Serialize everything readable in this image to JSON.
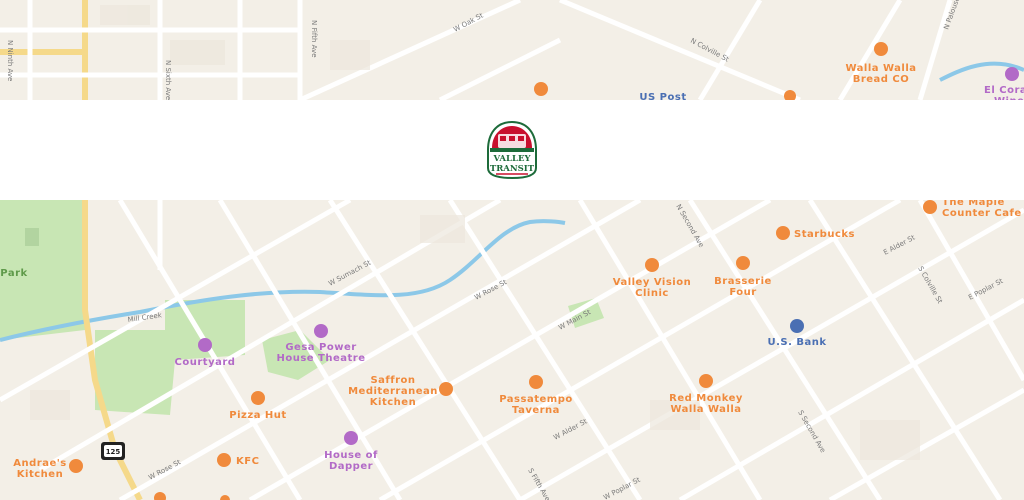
{
  "colors": {
    "background": "#f3efe7",
    "road": "#ffffff",
    "park": "#c8e6b4",
    "water": "#8cc8e8",
    "highway": "#f5d98a",
    "food": "#f08a3c",
    "entertainment": "#b26ac7",
    "service": "#4a6fb3"
  },
  "header": {
    "logo_text_line1": "VALLEY",
    "logo_text_line2": "TRANSIT"
  },
  "map": {
    "pois": [
      {
        "name": "Walla Walla\nBread CO",
        "category": "food",
        "icon": "bakery-icon"
      },
      {
        "name": "US Post",
        "category": "service",
        "icon": "post-icon"
      },
      {
        "name": "El Cora\nWine",
        "category": "entertainment",
        "icon": "wine-icon"
      },
      {
        "name": "The Maple\nCounter Cafe",
        "category": "food",
        "icon": "restaurant-icon"
      },
      {
        "name": "Starbucks",
        "category": "food",
        "icon": "coffee-icon"
      },
      {
        "name": "Valley Vision\nClinic",
        "category": "food",
        "icon": "clinic-icon"
      },
      {
        "name": "Brasserie\nFour",
        "category": "food",
        "icon": "restaurant-icon"
      },
      {
        "name": "U.S. Bank",
        "category": "service",
        "icon": "bank-icon"
      },
      {
        "name": "Courtyard",
        "category": "entertainment",
        "icon": "bed-icon"
      },
      {
        "name": "Gesa Power\nHouse Theatre",
        "category": "entertainment",
        "icon": "theatre-icon"
      },
      {
        "name": "Saffron\nMediterranean\nKitchen",
        "category": "food",
        "icon": "restaurant-icon"
      },
      {
        "name": "Passatempo\nTaverna",
        "category": "food",
        "icon": "restaurant-icon"
      },
      {
        "name": "Red Monkey\nWalla Walla",
        "category": "food",
        "icon": "restaurant-icon"
      },
      {
        "name": "Pizza Hut",
        "category": "food",
        "icon": "pizza-icon"
      },
      {
        "name": "House of\nDapper",
        "category": "entertainment",
        "icon": "shopping-icon"
      },
      {
        "name": "KFC",
        "category": "food",
        "icon": "restaurant-icon"
      },
      {
        "name": "Andrae's\nKitchen",
        "category": "food",
        "icon": "restaurant-icon"
      },
      {
        "name": "Park",
        "category": "park",
        "icon": ""
      }
    ],
    "streets": [
      "W Oak St",
      "N Colville St",
      "N Palouse St",
      "W Sumach St",
      "W Rose St",
      "W Main St",
      "W Alder St",
      "E Alder St",
      "E Poplar St",
      "W Poplar St",
      "Mill Creek",
      "S Colville St",
      "S Second Ave",
      "S Fifth Ave",
      "N Second Ave",
      "N Ninth Ave",
      "N Fifth Ave",
      "N Sixth Ave",
      "W Rose St"
    ],
    "highway_shield": "125"
  }
}
